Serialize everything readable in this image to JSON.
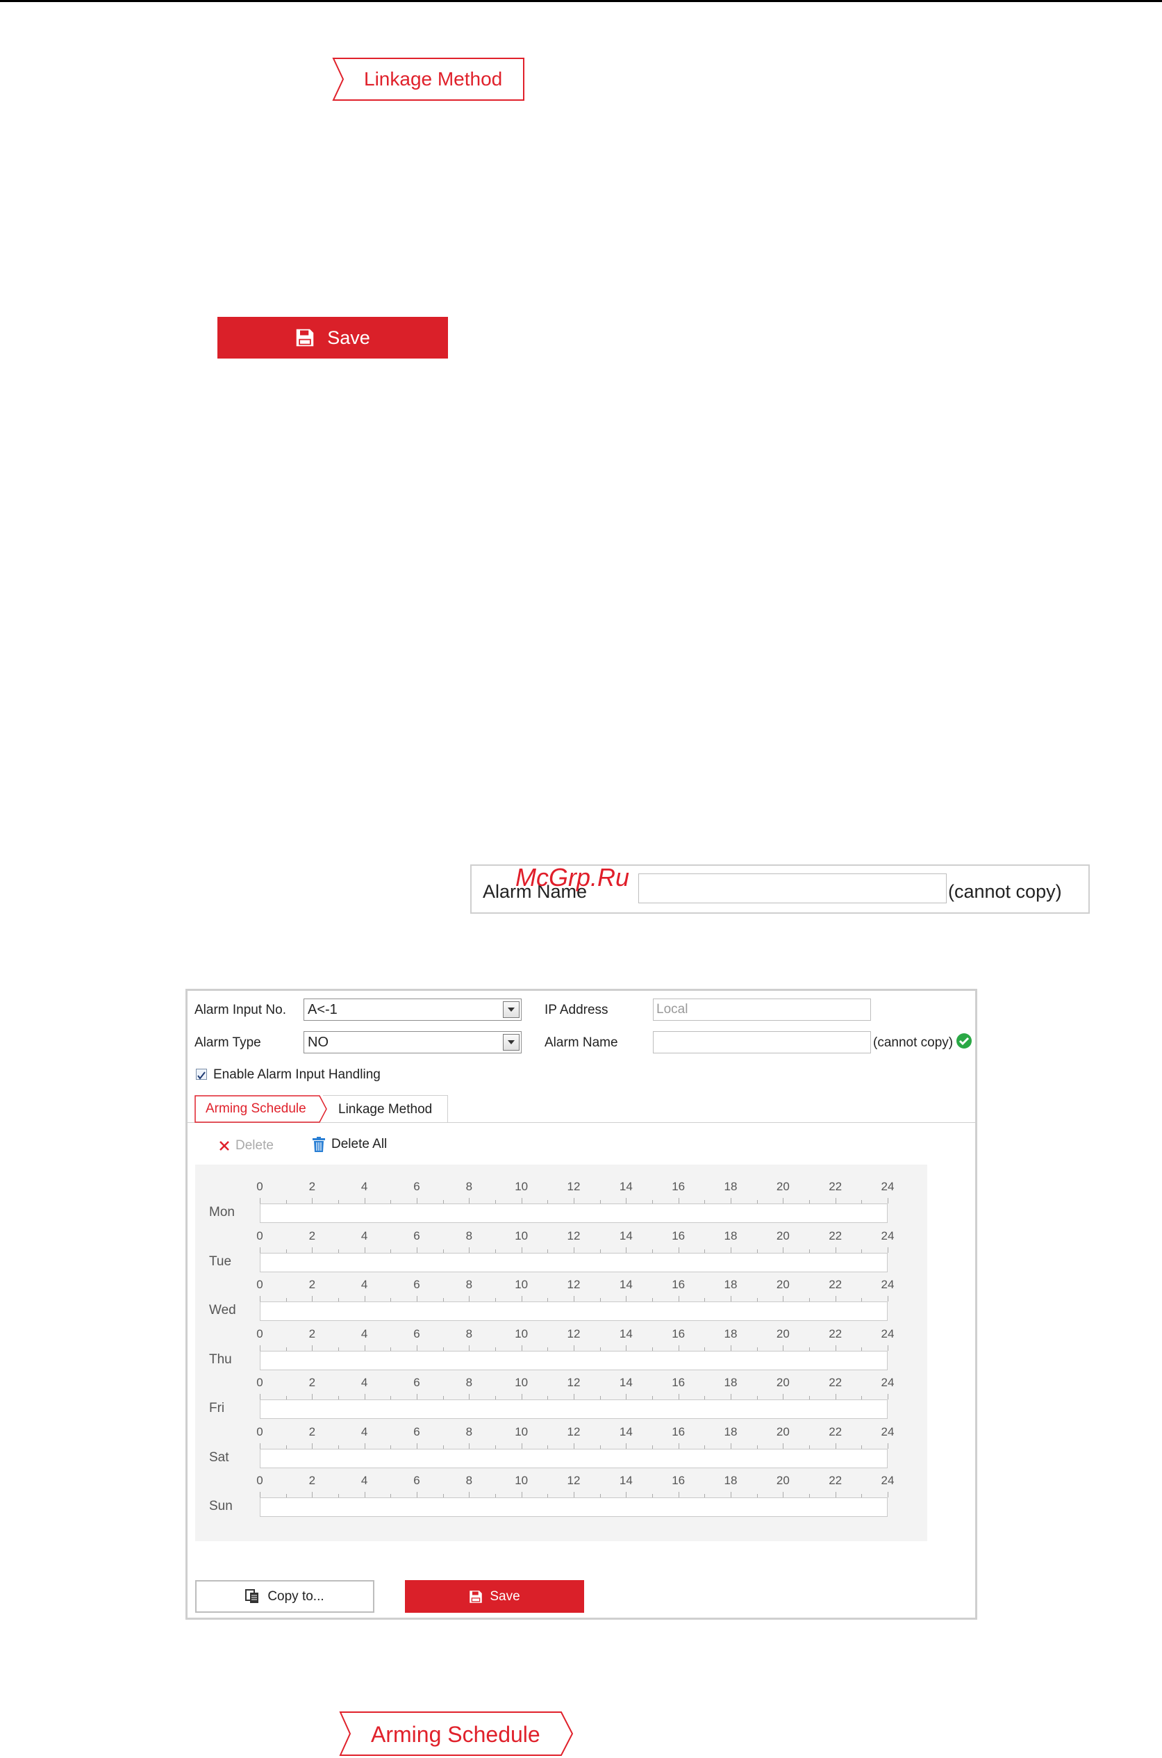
{
  "callouts": {
    "linkage_method": "Linkage Method",
    "save": "Save",
    "arming_schedule": "Arming Schedule"
  },
  "alarm_name_snippet": {
    "label": "Alarm Name",
    "value": "",
    "note": "(cannot copy)",
    "watermark": "McGrp.Ru"
  },
  "form": {
    "alarm_input_no_label": "Alarm Input No.",
    "alarm_input_no_value": "A<-1",
    "ip_address_label": "IP Address",
    "ip_address_placeholder": "Local",
    "alarm_type_label": "Alarm Type",
    "alarm_type_value": "NO",
    "alarm_name_label": "Alarm Name",
    "alarm_name_value": "",
    "cannot_copy_note": "(cannot copy)",
    "enable_handling_label": "Enable Alarm Input Handling",
    "enable_handling_checked": true
  },
  "tabs": [
    "Arming Schedule",
    "Linkage Method"
  ],
  "toolbar": {
    "delete": "Delete",
    "delete_all": "Delete All"
  },
  "schedule": {
    "hours": [
      "0",
      "2",
      "4",
      "6",
      "8",
      "10",
      "12",
      "14",
      "16",
      "18",
      "20",
      "22",
      "24"
    ],
    "days": [
      "Mon",
      "Tue",
      "Wed",
      "Thu",
      "Fri",
      "Sat",
      "Sun"
    ]
  },
  "buttons": {
    "copy_to": "Copy to...",
    "save": "Save"
  },
  "colors": {
    "accent": "#da2029",
    "tab_text": "#e0212b",
    "ok_green": "#2aa845"
  }
}
